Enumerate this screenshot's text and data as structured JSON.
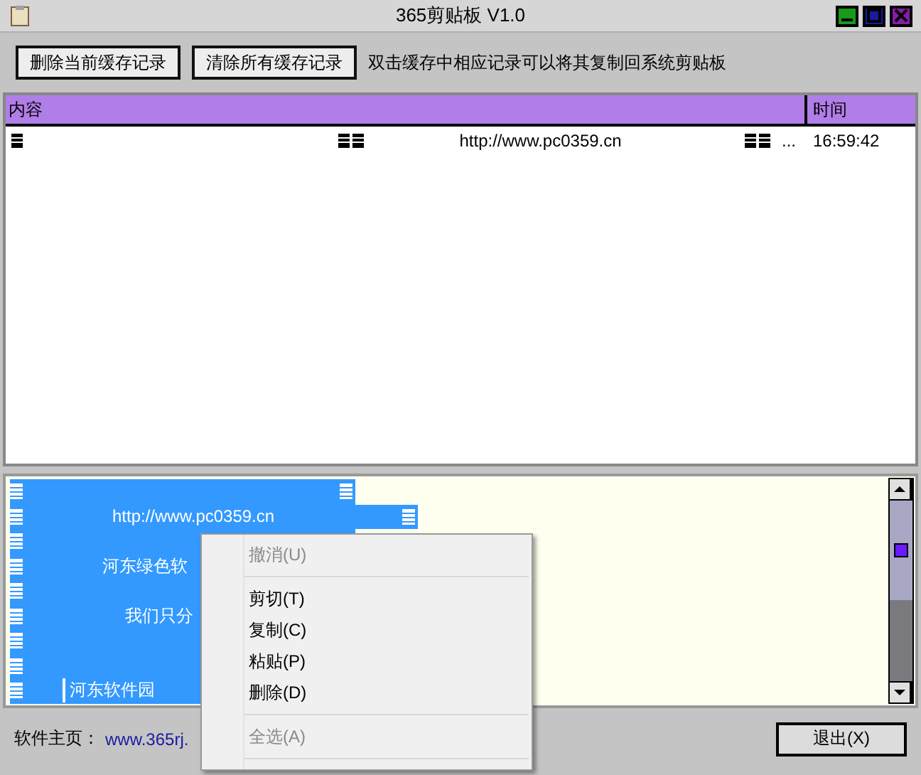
{
  "window": {
    "title": "365剪贴板 V1.0"
  },
  "toolbar": {
    "buttons": [
      "删除当前缓存记录",
      "清除所有缓存记录"
    ],
    "hint": "双击缓存中相应记录可以将其复制回系统剪贴板"
  },
  "table": {
    "columns": [
      "内容",
      "时间"
    ],
    "rows": [
      {
        "content": [
          {
            "kind": "glyph"
          },
          {
            "kind": "gap"
          },
          {
            "kind": "glyph2"
          },
          {
            "kind": "gap"
          },
          {
            "kind": "text",
            "text": "http://www.pc0359.cn"
          },
          {
            "kind": "gap"
          },
          {
            "kind": "glyph2"
          },
          {
            "kind": "text",
            "text": "..."
          }
        ],
        "time": "16:59:42"
      }
    ]
  },
  "editor": {
    "lines": [
      {
        "selected": true,
        "trailing_glyph": true
      },
      {
        "text": "http://www.pc0359.cn",
        "selected": true,
        "trailing_glyph": true
      },
      {
        "selected": true,
        "trailing_glyph": false
      },
      {
        "text": "河东绿色软",
        "selected": true,
        "trailing_glyph": false
      },
      {
        "selected": true,
        "trailing_glyph": false
      },
      {
        "text": "我们只分",
        "selected": true,
        "trailing_glyph": false
      },
      {
        "selected": true,
        "trailing_glyph": false
      },
      {
        "selected": true,
        "trailing_glyph": false
      },
      {
        "text": "河东软件园",
        "selected": true,
        "trailing_glyph": false
      }
    ]
  },
  "footer": {
    "label": "软件主页：",
    "link": "www.365rj.",
    "exit_button": "退出(X)"
  },
  "context_menu": [
    {
      "kind": "item",
      "label": "撤消(U)",
      "disabled": true
    },
    {
      "kind": "separator"
    },
    {
      "kind": "item",
      "label": "剪切(T)",
      "disabled": false
    },
    {
      "kind": "item",
      "label": "复制(C)",
      "disabled": false
    },
    {
      "kind": "item",
      "label": "粘贴(P)",
      "disabled": false
    },
    {
      "kind": "item",
      "label": "删除(D)",
      "disabled": false
    },
    {
      "kind": "separator"
    },
    {
      "kind": "item",
      "label": "全选(A)",
      "disabled": true
    },
    {
      "kind": "separator"
    }
  ]
}
